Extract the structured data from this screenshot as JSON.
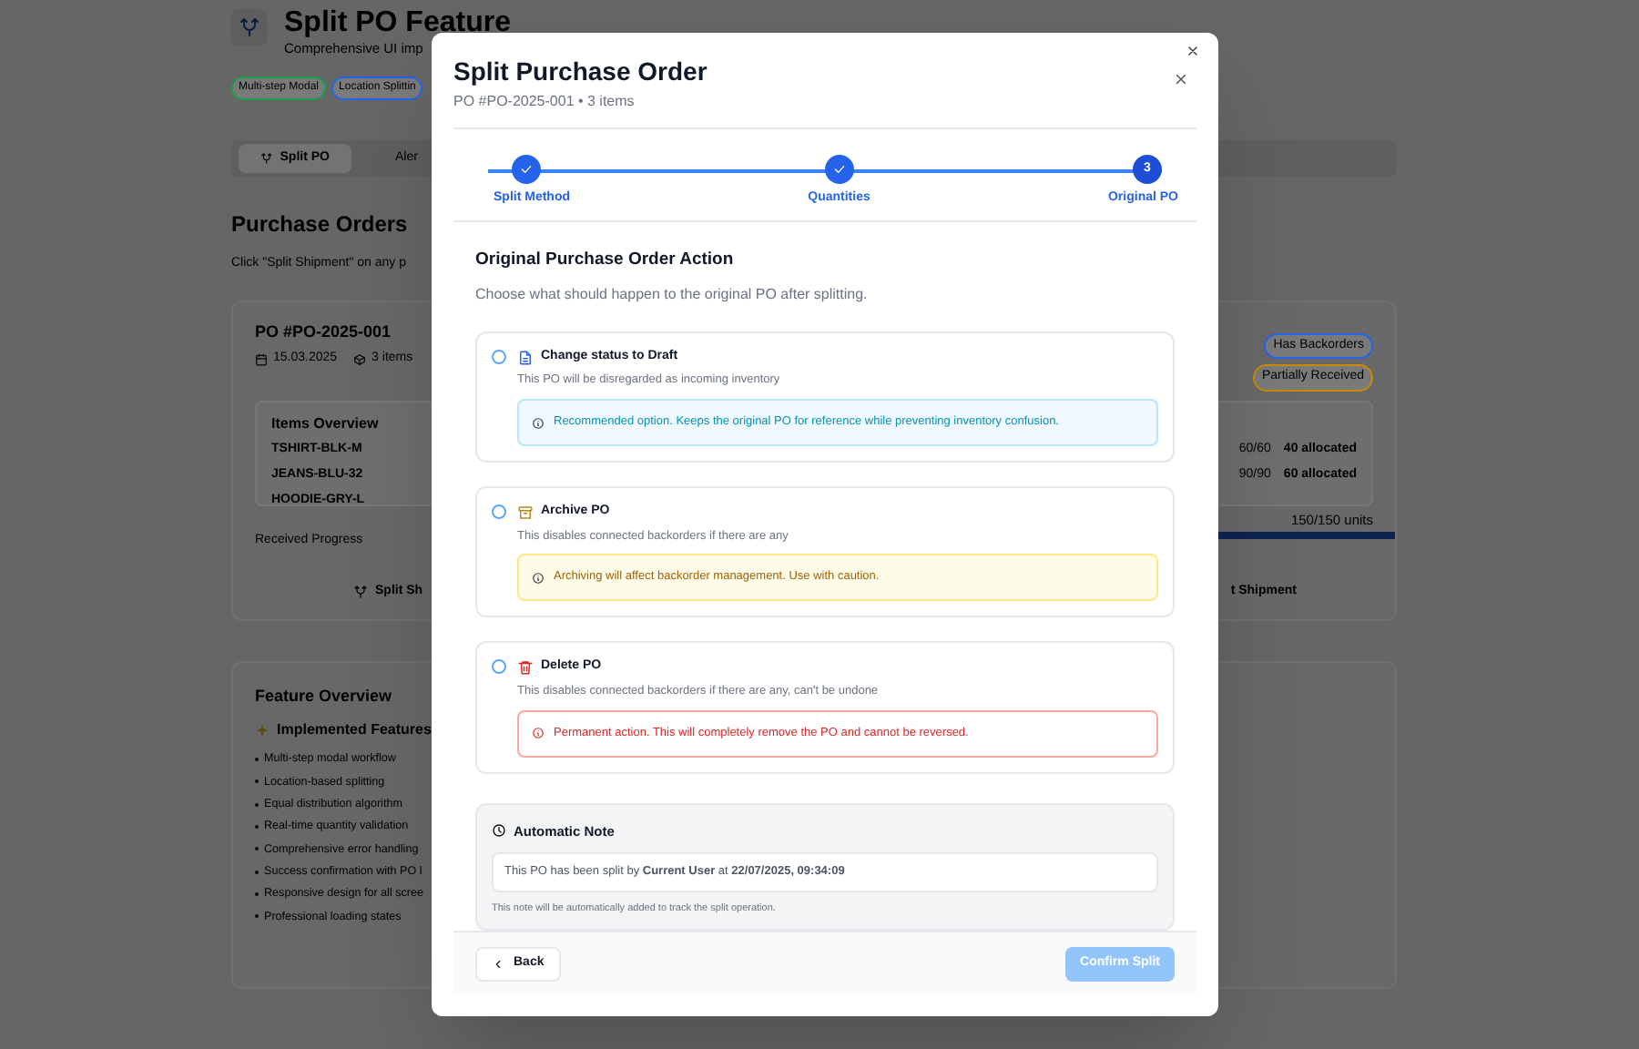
{
  "page": {
    "title": "Split PO Feature",
    "subtitle": "Comprehensive UI imp",
    "badges": [
      {
        "label": "Multi-step Modal",
        "color": "#16a34a"
      },
      {
        "label": "Location Splittin",
        "color": "#2563eb"
      }
    ],
    "tabs": [
      {
        "label": "Split PO",
        "selected": true
      },
      {
        "label": "Aler",
        "selected": false
      }
    ],
    "heading": "Purchase Orders",
    "hint": "Click \"Split Shipment\" on any p",
    "po_card": {
      "title": "PO #PO-2025-001",
      "date": "15.03.2025",
      "items_count": "3 items",
      "status_badges": [
        {
          "label": "Has Backorders",
          "color": "#2563eb"
        },
        {
          "label": "Partially Received",
          "color": "#ca8a04"
        }
      ],
      "items_title": "Items Overview",
      "items": [
        {
          "sku": "TSHIRT-BLK-M",
          "qty": "60/60",
          "allocated": "40 allocated"
        },
        {
          "sku": "JEANS-BLU-32",
          "qty": "90/90",
          "allocated": "60 allocated"
        },
        {
          "sku": "HOODIE-GRY-L"
        }
      ],
      "progress": {
        "label": "Received Progress",
        "reading": "150/150 units",
        "level": 1
      },
      "buttons": [
        "Split Sh",
        "t Shipment"
      ]
    },
    "features": {
      "title": "Feature Overview",
      "subtitle": "Implemented Features",
      "items": [
        "Multi-step modal workflow",
        "Location-based splitting",
        "Equal distribution algorithm",
        "Real-time quantity validation",
        "Comprehensive error handling",
        "Success confirmation with PO l",
        "Responsive design for all scree",
        "Professional loading states"
      ]
    }
  },
  "modal": {
    "title": "Split Purchase Order",
    "subtitle": "PO #PO-2025-001 • 3 items",
    "steps": [
      {
        "label": "Split Method",
        "done": true
      },
      {
        "label": "Quantities",
        "done": true
      },
      {
        "label": "Original PO",
        "done": false,
        "number": "3"
      }
    ],
    "heading": "Original Purchase Order Action",
    "hint": "Choose what should happen to the original PO after splitting.",
    "options": [
      {
        "kind": "draft",
        "title": "Change status to Draft",
        "description": "This PO will be disregarded as incoming inventory",
        "notice": "Recommended option. Keeps the original PO for reference while preventing inventory confusion.",
        "selected": false
      },
      {
        "kind": "archive",
        "title": "Archive PO",
        "description": "This disables connected backorders if there are any",
        "notice": "Archiving will affect backorder management. Use with caution.",
        "selected": false
      },
      {
        "kind": "delete",
        "title": "Delete PO",
        "description": "This disables connected backorders if there are any, can't be undone",
        "notice": "Permanent action. This will completely remove the PO and cannot be reversed.",
        "selected": false
      }
    ],
    "note": {
      "title": "Automatic Note",
      "text": "This PO has been split by **Current User** at **22/07/2025, 09:34:09**",
      "footnote": "This note will be automatically added to track the split operation."
    },
    "back": "Back",
    "confirm": {
      "label": "Confirm Split",
      "disabled": true
    }
  }
}
